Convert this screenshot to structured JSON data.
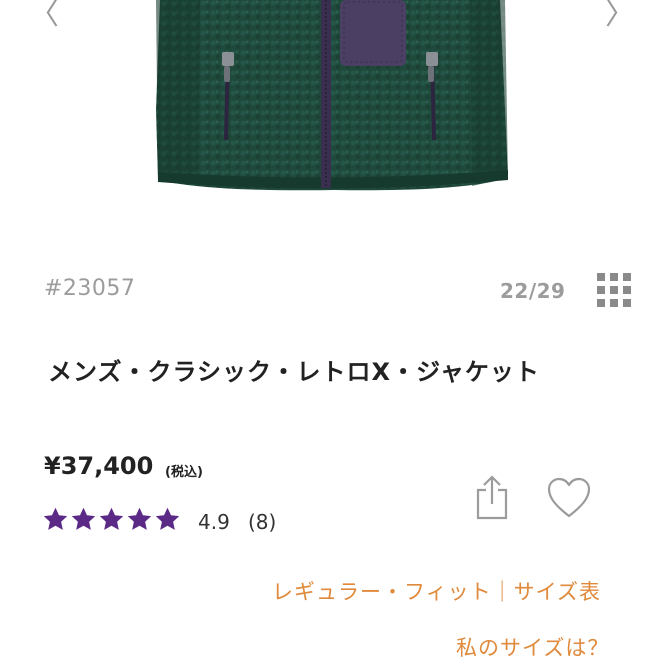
{
  "gallery": {
    "prev_icon": "chevron-left-icon",
    "next_icon": "chevron-right-icon",
    "prev_glyph": "〈",
    "next_glyph": "〉",
    "image": "green fleece jacket with purple chest pocket",
    "colors": {
      "fleece": "#1f4a3b",
      "pocket": "#4b3f64",
      "zip": "#3a2f4f"
    }
  },
  "product": {
    "number": "#23057",
    "counter": "22/29",
    "title": "メンズ・クラシック・レトロX・ジャケット",
    "price": "¥37,400",
    "tax_note": "(税込)",
    "rating": {
      "stars": 5,
      "value": "4.9",
      "count": "(8)",
      "star_color": "#5b2a86"
    }
  },
  "actions": {
    "grid_icon": "grid-icon",
    "share_icon": "share-icon",
    "favorite_icon": "heart-icon"
  },
  "links": {
    "fit": "レギュラー・フィット｜サイズ表",
    "my_size": "私のサイズは？",
    "color": "#e08a3c"
  }
}
